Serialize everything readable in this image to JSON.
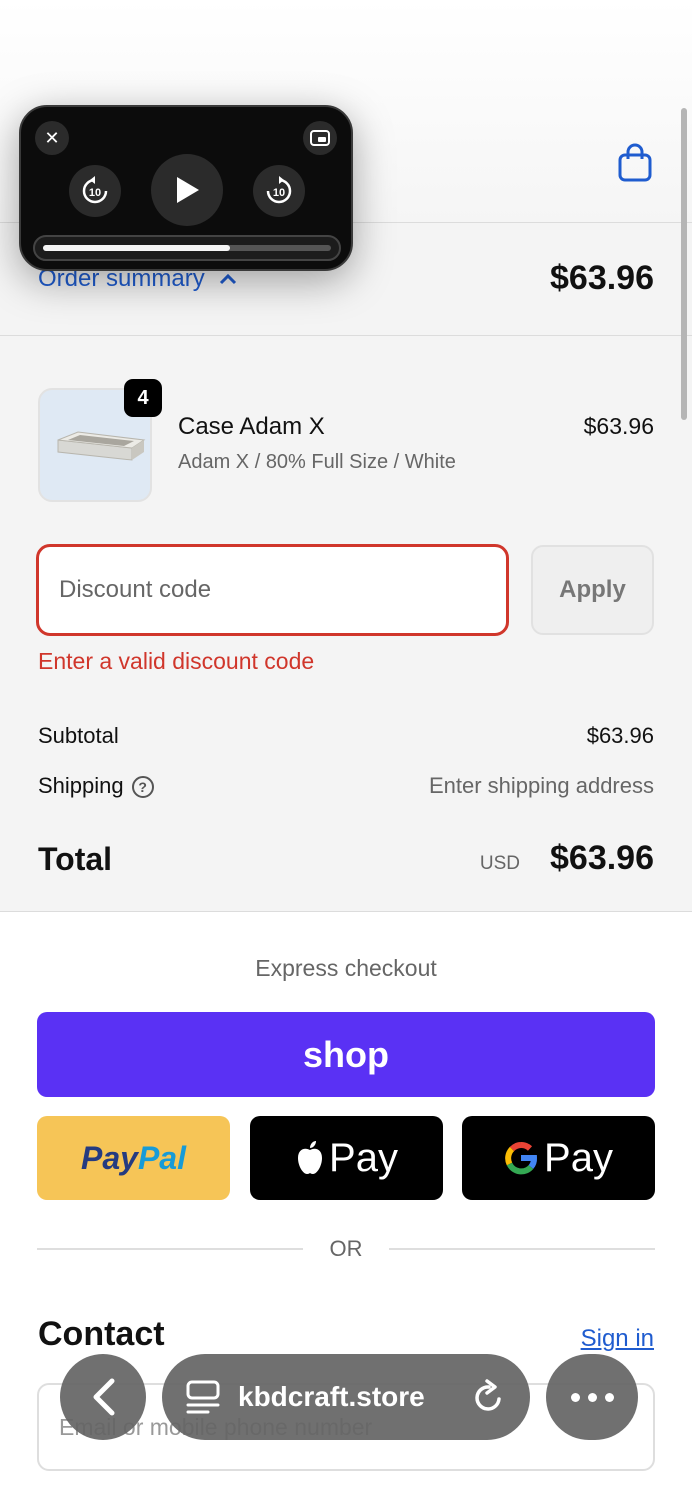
{
  "order_summary": {
    "toggle_label": "Order summary",
    "total": "$63.96"
  },
  "product": {
    "quantity": "4",
    "name": "Case Adam X",
    "variant": "Adam X / 80% Full Size / White",
    "price": "$63.96"
  },
  "discount": {
    "placeholder": "Discount code",
    "apply_label": "Apply",
    "error": "Enter a valid discount code"
  },
  "totals": {
    "subtotal_label": "Subtotal",
    "subtotal_value": "$63.96",
    "shipping_label": "Shipping",
    "shipping_value": "Enter shipping address",
    "total_label": "Total",
    "currency": "USD",
    "total_value": "$63.96"
  },
  "express": {
    "title": "Express checkout",
    "shop_label": "shop",
    "paypal_part1": "Pay",
    "paypal_part2": "Pal",
    "apple_label": "Pay",
    "google_label": "Pay",
    "or_label": "OR"
  },
  "contact": {
    "title": "Contact",
    "signin_label": "Sign in",
    "email_placeholder": "Email or mobile phone number"
  },
  "media_player": {
    "skip_back_label": "10",
    "skip_forward_label": "10",
    "progress": 0.65
  },
  "browser": {
    "url": "kbdcraft.store"
  },
  "colors": {
    "accent": "#1f5ccf",
    "error": "#d0362b",
    "shop": "#5a31f4",
    "paypal": "#f6c557"
  }
}
